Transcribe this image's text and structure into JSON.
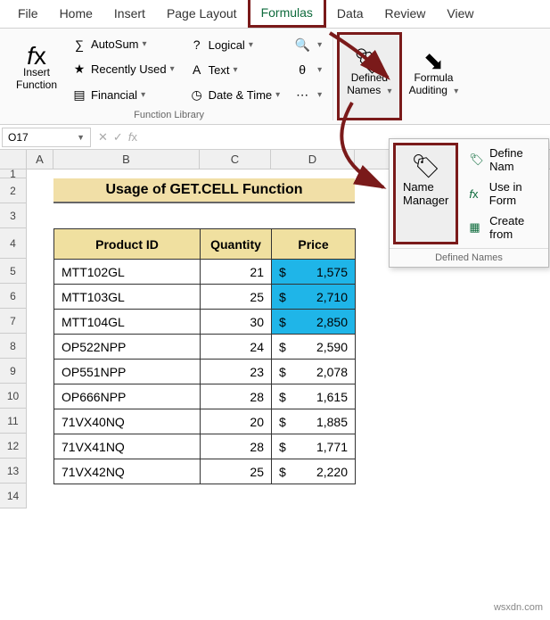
{
  "tabs": [
    "File",
    "Home",
    "Insert",
    "Page Layout",
    "Formulas",
    "Data",
    "Review",
    "View"
  ],
  "active_tab": "Formulas",
  "ribbon": {
    "insert_function": "Insert\nFunction",
    "autosum": "AutoSum",
    "recently_used": "Recently Used",
    "financial": "Financial",
    "logical": "Logical",
    "text": "Text",
    "date_time": "Date & Time",
    "function_library": "Function Library",
    "defined_names": "Defined\nNames",
    "formula_auditing": "Formula\nAuditing"
  },
  "namebox": "O17",
  "dropdown": {
    "name_manager": "Name\nManager",
    "define_name": "Define Nam",
    "use_in_formula": "Use in Form",
    "create_from": "Create from",
    "footer": "Defined Names"
  },
  "columns": [
    "A",
    "B",
    "C",
    "D"
  ],
  "rows": [
    "1",
    "2",
    "3",
    "4",
    "5",
    "6",
    "7",
    "8",
    "9",
    "10",
    "11",
    "12",
    "13",
    "14"
  ],
  "title": "Usage of GET.CELL Function",
  "headers": {
    "b": "Product ID",
    "c": "Quantity",
    "d": "Price"
  },
  "data": [
    {
      "id": "MTT102GL",
      "qty": 21,
      "price": "1,575",
      "hl": true
    },
    {
      "id": "MTT103GL",
      "qty": 25,
      "price": "2,710",
      "hl": true
    },
    {
      "id": "MTT104GL",
      "qty": 30,
      "price": "2,850",
      "hl": true
    },
    {
      "id": "OP522NPP",
      "qty": 24,
      "price": "2,590",
      "hl": false
    },
    {
      "id": "OP551NPP",
      "qty": 23,
      "price": "2,078",
      "hl": false
    },
    {
      "id": "OP666NPP",
      "qty": 28,
      "price": "1,615",
      "hl": false
    },
    {
      "id": "71VX40NQ",
      "qty": 20,
      "price": "1,885",
      "hl": false
    },
    {
      "id": "71VX41NQ",
      "qty": 28,
      "price": "1,771",
      "hl": false
    },
    {
      "id": "71VX42NQ",
      "qty": 25,
      "price": "2,220",
      "hl": false
    }
  ],
  "currency": "$",
  "watermark": "wsxdn.com"
}
